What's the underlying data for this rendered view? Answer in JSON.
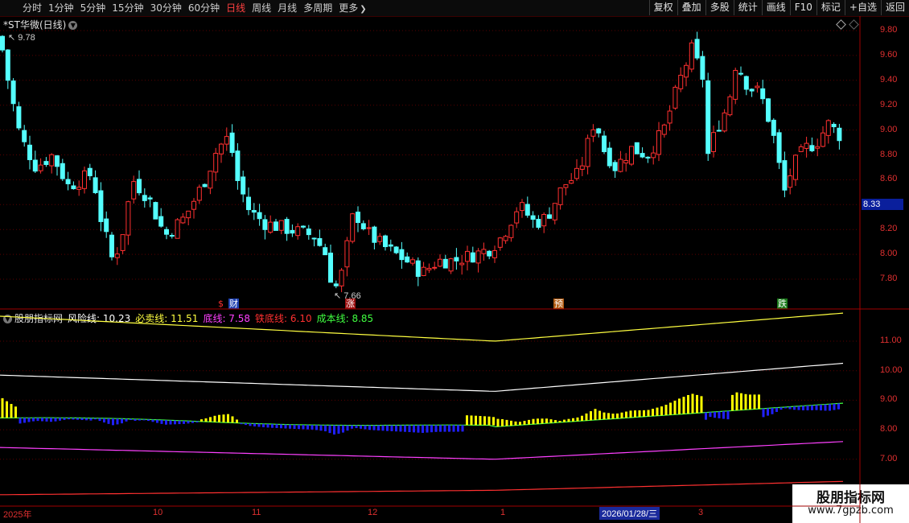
{
  "toolbar": {
    "periods": [
      "分时",
      "1分钟",
      "5分钟",
      "15分钟",
      "30分钟",
      "60分钟",
      "日线",
      "周线",
      "月线",
      "多周期"
    ],
    "active": "日线",
    "more": "更多",
    "right_buttons": [
      "复权",
      "叠加",
      "多股",
      "统计",
      "画线",
      "F10",
      "标记",
      "+自选",
      "返回"
    ]
  },
  "price_panel": {
    "title": "*ST华微(日线)",
    "high_label": "9.78",
    "low_label": "7.66",
    "current_price": "8.33",
    "axis": [
      "9.80",
      "9.60",
      "9.40",
      "9.20",
      "9.00",
      "8.80",
      "8.60",
      "8.40",
      "8.20",
      "8.00",
      "7.80"
    ],
    "markers": [
      {
        "text": "$",
        "color": "#ff3030",
        "bg": "#000"
      },
      {
        "text": "财",
        "color": "#ffffff",
        "bg": "#1c3fb0"
      },
      {
        "text": "涨",
        "color": "#ffffff",
        "bg": "#9c1010"
      },
      {
        "text": "预",
        "color": "#ffffff",
        "bg": "#b05a10"
      },
      {
        "text": "跌",
        "color": "#ffffff",
        "bg": "#1a7a1a"
      }
    ]
  },
  "indicator_panel": {
    "name": "股朋指标网",
    "items": [
      {
        "label": "风险线:",
        "value": "10.23",
        "color": "#ffffff"
      },
      {
        "label": "必卖线:",
        "value": "11.51",
        "color": "#ffff40"
      },
      {
        "label": "底线:",
        "value": "7.58",
        "color": "#ff40ff"
      },
      {
        "label": "铁底线:",
        "value": "6.10",
        "color": "#ff3030"
      },
      {
        "label": "成本线:",
        "value": "8.85",
        "color": "#40ff40"
      }
    ],
    "axis": [
      "11.00",
      "10.00",
      "9.00",
      "8.00",
      "7.00"
    ]
  },
  "dates": [
    "2025年",
    "10",
    "11",
    "12",
    "1",
    "3"
  ],
  "date_cursor": "2026/01/28/三",
  "watermark": {
    "title": "股朋指标网",
    "url": "www.7gpzb.com"
  },
  "colors": {
    "up": "#ff3030",
    "down": "#54ffff",
    "grid": "#5a0000",
    "buy_bar": "#ffff00",
    "sell_bar": "#2020ff"
  }
}
